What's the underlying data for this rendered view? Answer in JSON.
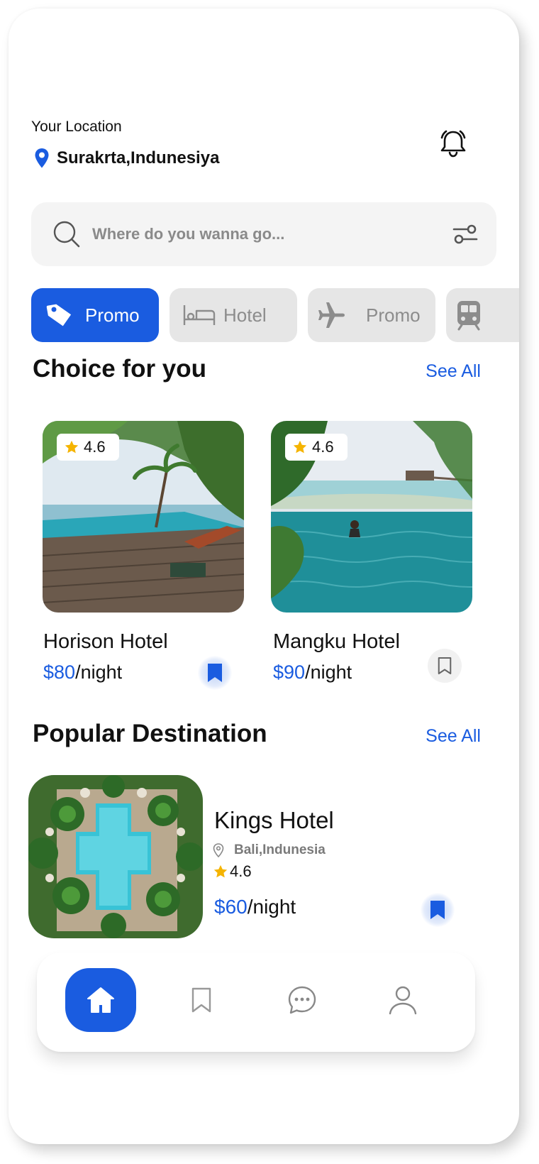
{
  "colors": {
    "accent": "#1a5ce0",
    "star": "#f5b400",
    "chip_inactive": "#e6e6e6",
    "search_bg": "#f4f4f4"
  },
  "header": {
    "location_label": "Your Location",
    "location_value": "Surakrta,Indunesiya",
    "location_icon": "map-pin-icon",
    "notification_icon": "bell-icon"
  },
  "search": {
    "placeholder": "Where do you wanna go...",
    "search_icon": "search-icon",
    "filter_icon": "filter-sliders-icon"
  },
  "categories": [
    {
      "label": "Promo",
      "icon": "tag-icon",
      "active": true
    },
    {
      "label": "Hotel",
      "icon": "bed-icon",
      "active": false
    },
    {
      "label": "Promo",
      "icon": "airplane-icon",
      "active": false
    },
    {
      "label": "",
      "icon": "train-icon",
      "active": false
    }
  ],
  "choice": {
    "title": "Choice for you",
    "see_all": "See All",
    "cards": [
      {
        "rating": "4.6",
        "name": "Horison Hotel",
        "price": "$80",
        "unit": "/night",
        "bookmarked": true
      },
      {
        "rating": "4.6",
        "name": "Mangku Hotel",
        "price": "$90",
        "unit": "/night",
        "bookmarked": false
      }
    ]
  },
  "popular": {
    "title": "Popular Destination",
    "see_all": "See All",
    "item": {
      "name": "Kings Hotel",
      "location": "Bali,Indunesia",
      "rating": "4.6",
      "price": "$60",
      "unit": "/night",
      "bookmarked": true
    }
  },
  "tabbar": [
    {
      "icon": "home-icon",
      "active": true
    },
    {
      "icon": "bookmark-icon",
      "active": false
    },
    {
      "icon": "chat-icon",
      "active": false
    },
    {
      "icon": "profile-icon",
      "active": false
    }
  ]
}
